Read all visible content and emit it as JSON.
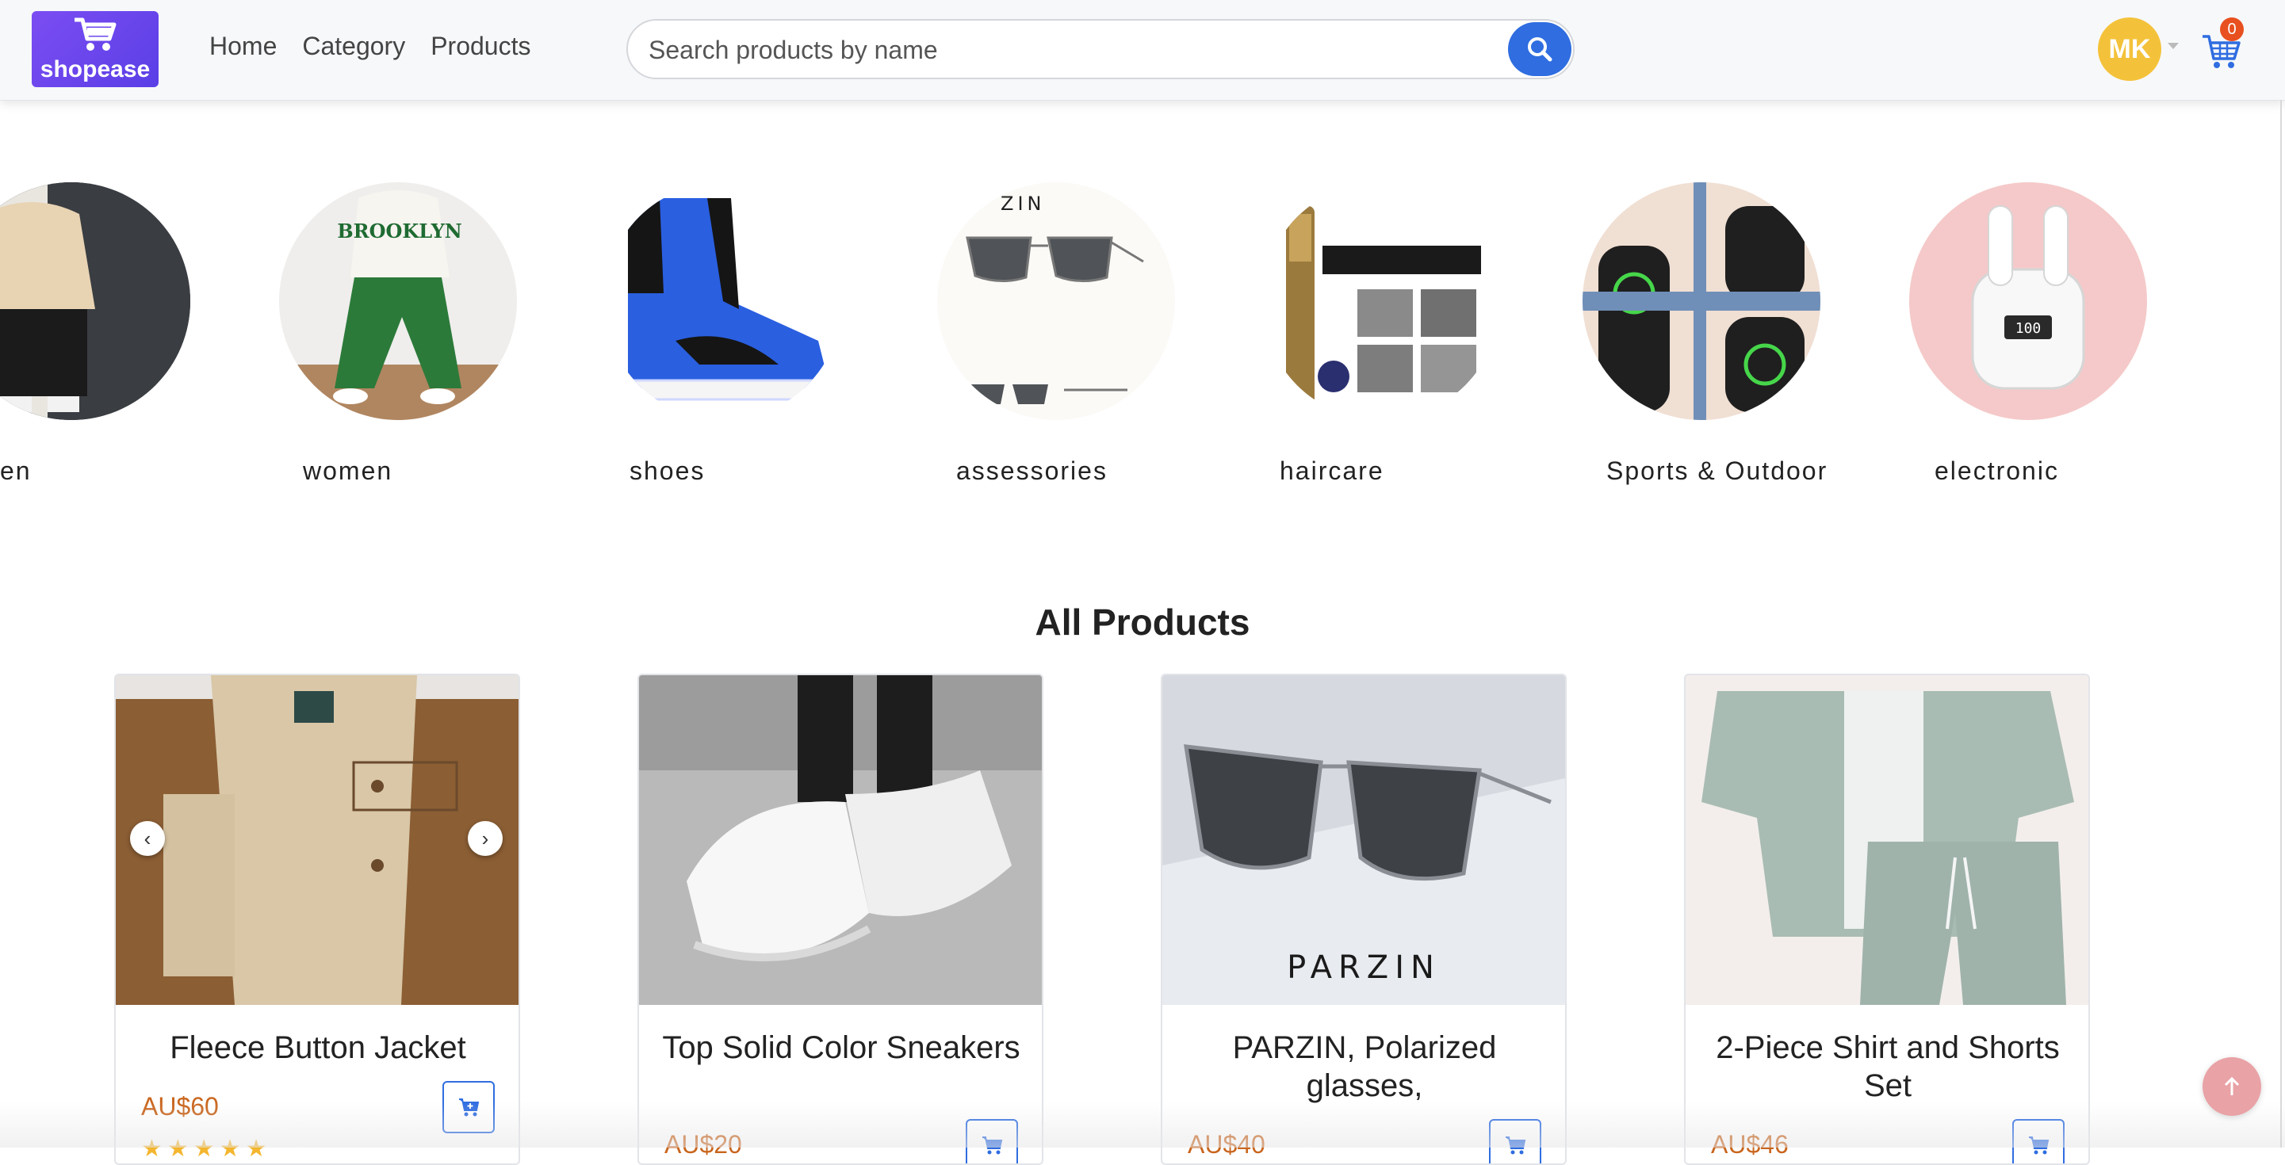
{
  "brand": {
    "name": "shopease",
    "accent": "#6a45ee"
  },
  "nav": {
    "links": [
      "Home",
      "Category",
      "Products"
    ]
  },
  "search": {
    "placeholder": "Search products by name",
    "icon": "search-icon",
    "button_color": "#2f6de0"
  },
  "user": {
    "initials": "MK",
    "avatar_color": "#f4c23a"
  },
  "cart": {
    "count": "0",
    "icon": "cart-icon",
    "badge_color": "#e8501f"
  },
  "categories": [
    {
      "label": "en"
    },
    {
      "label": "women"
    },
    {
      "label": "shoes"
    },
    {
      "label": "assessories"
    },
    {
      "label": "haircare"
    },
    {
      "label": "Sports & Outdoor"
    },
    {
      "label": "electronic"
    }
  ],
  "section": {
    "title": "All Products"
  },
  "products": [
    {
      "title": "Fleece Button Jacket",
      "price": "AU$60",
      "rating": 5
    },
    {
      "title": "Top Solid Color Sneakers",
      "price": "AU$20"
    },
    {
      "title": "PARZIN, Polarized glasses,",
      "price": "AU$40",
      "image_text": "PARZIN"
    },
    {
      "title": "2-Piece Shirt and Shorts Set",
      "price": "AU$46"
    }
  ],
  "carousel": {
    "prev": "‹",
    "next": "›"
  }
}
